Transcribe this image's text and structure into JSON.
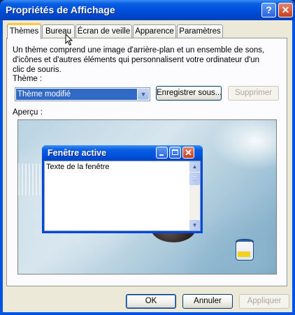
{
  "window": {
    "title": "Propriétés de Affichage",
    "help_label": "?",
    "close_label": "✕"
  },
  "tabs": [
    {
      "label": "Thèmes",
      "active": true
    },
    {
      "label": "Bureau",
      "active": false
    },
    {
      "label": "Écran de veille",
      "active": false
    },
    {
      "label": "Apparence",
      "active": false
    },
    {
      "label": "Paramètres",
      "active": false
    }
  ],
  "themes_panel": {
    "description": "Un thème comprend une image d'arrière-plan et un ensemble de sons, d'icônes et d'autres éléments qui personnalisent votre ordinateur d'un clic de souris.",
    "theme_label": "Thème :",
    "theme_selected": "Thème modifié",
    "save_button": "Enregistrer sous...",
    "delete_button": "Supprimer",
    "preview_label": "Aperçu :"
  },
  "preview": {
    "window_title": "Fenêtre active",
    "window_text": "Texte de la fenêtre",
    "close_label": "✕"
  },
  "footer": {
    "ok": "OK",
    "cancel": "Annuler",
    "apply": "Appliquer"
  },
  "colors": {
    "title_bar": "#0054e3",
    "selection": "#316ac5",
    "dialog_bg": "#ece9d8"
  }
}
